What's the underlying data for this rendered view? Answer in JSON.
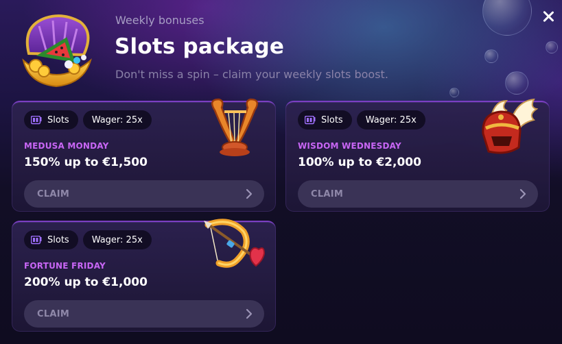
{
  "header": {
    "subtitle": "Weekly bonuses",
    "title": "Slots package",
    "description": "Don't miss a spin – claim your weekly slots boost."
  },
  "icons": {
    "close": "close-icon",
    "header": "treasure-shell-icon",
    "chip": "slot-machine-icon",
    "chevron": "chevron-right-icon"
  },
  "colors": {
    "accent": "#c866f5",
    "card_border": "#8c46dc",
    "button_bg": "#3a3356"
  },
  "cards": [
    {
      "tag_category": "Slots",
      "tag_wager": "Wager: 25x",
      "promo_name": "MEDUSA MONDAY",
      "offer": "150% up to €1,500",
      "button": "CLAIM",
      "art": "lyre-icon"
    },
    {
      "tag_category": "Slots",
      "tag_wager": "Wager: 25x",
      "promo_name": "WISDOM WEDNESDAY",
      "offer": "100% up to €2,000",
      "button": "CLAIM",
      "art": "winged-helmet-icon"
    },
    {
      "tag_category": "Slots",
      "tag_wager": "Wager: 25x",
      "promo_name": "FORTUNE FRIDAY",
      "offer": "200% up to €1,000",
      "button": "CLAIM",
      "art": "bow-and-arrow-icon"
    }
  ]
}
